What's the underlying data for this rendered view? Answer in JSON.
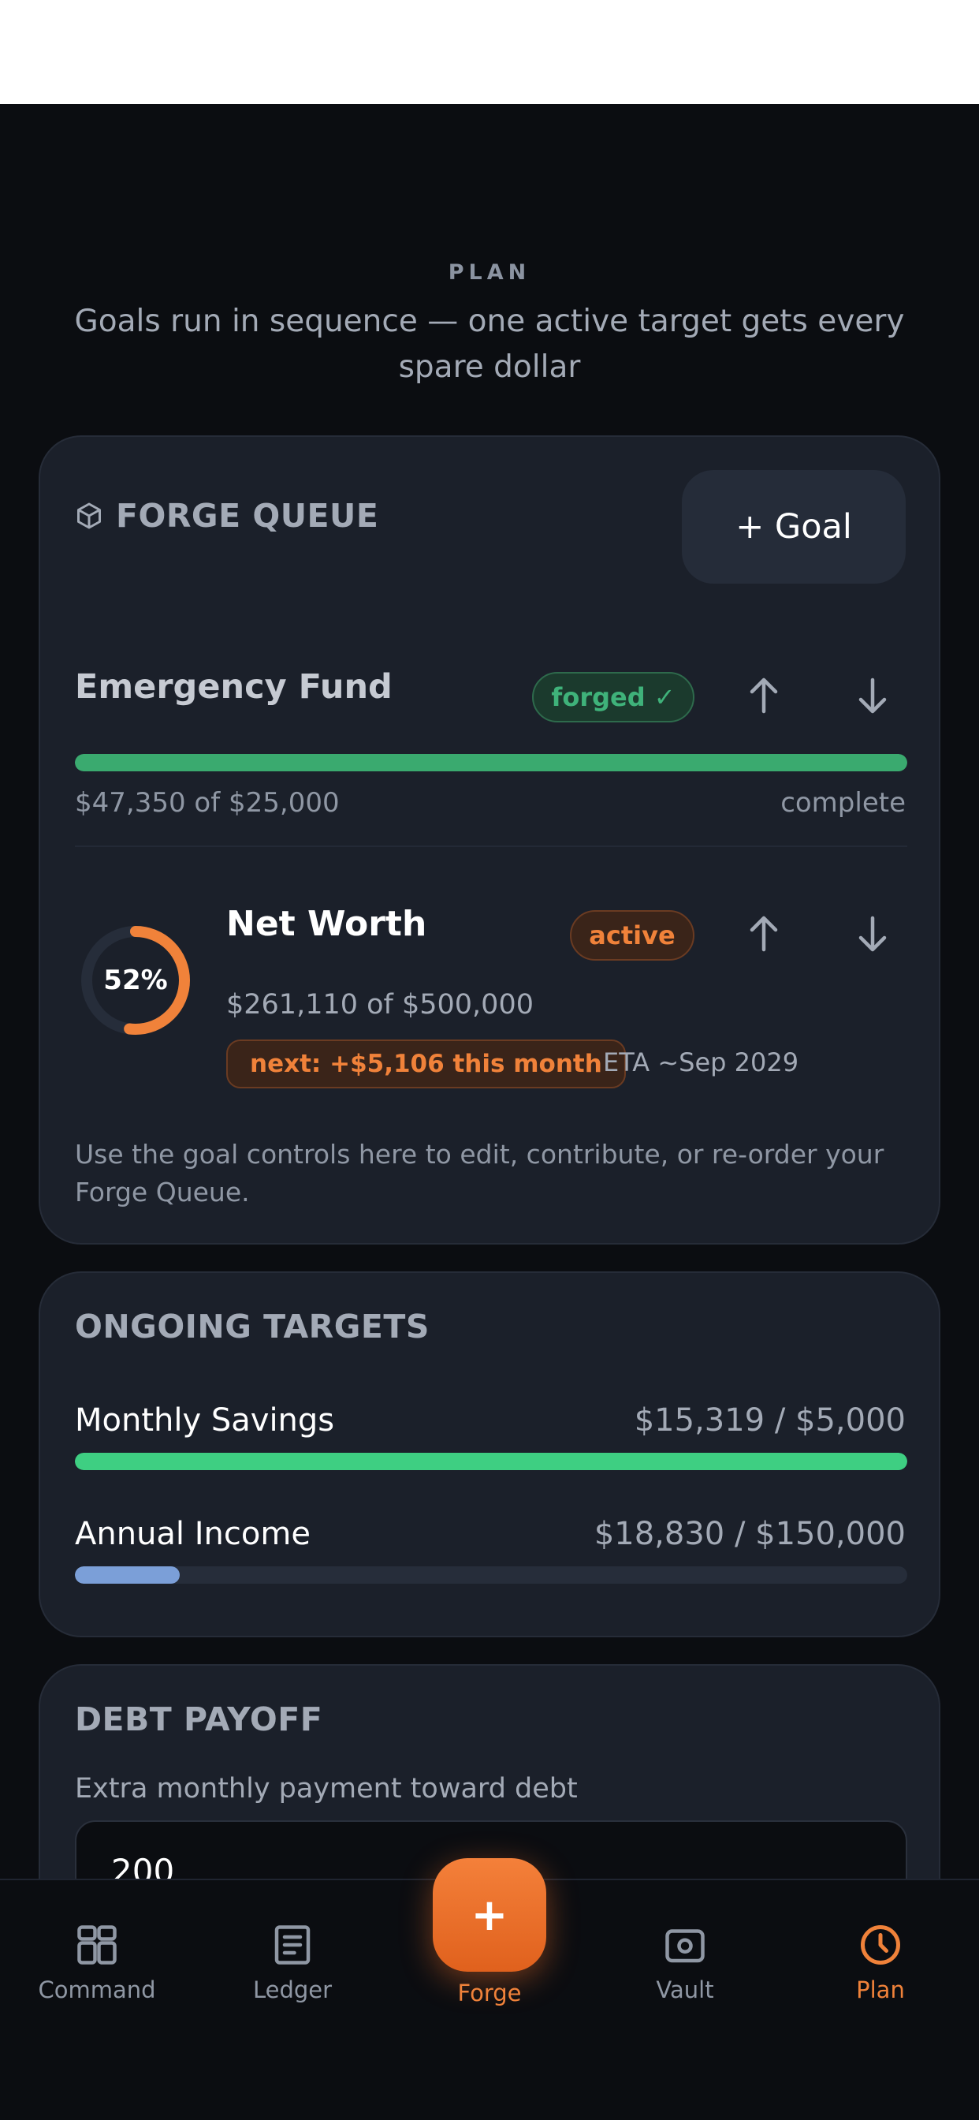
{
  "header": {
    "eyebrow": "PLAN",
    "subtitle": "Goals run in sequence — one active target gets every spare dollar"
  },
  "forge_queue": {
    "title": "FORGE QUEUE",
    "add_goal_label": "+ Goal",
    "goals": [
      {
        "name": "Emergency Fund",
        "badge": "forged ✓",
        "amount_text": "$47,350 of $25,000",
        "status_text": "complete",
        "progress": 1.0
      },
      {
        "name": "Net Worth",
        "badge": "active",
        "percent_label": "52%",
        "progress": 0.52,
        "amount_text": "$261,110 of $500,000",
        "next_text": "next: +$5,106 this month",
        "eta_text": "ETA ~Sep 2029"
      }
    ],
    "hint": "Use the goal controls here to edit, contribute, or re-order your Forge Queue."
  },
  "ongoing_targets": {
    "title": "ONGOING TARGETS",
    "rows": [
      {
        "label": "Monthly Savings",
        "value": "$15,319 / $5,000",
        "progress": 1.0,
        "color": "#3ecf82"
      },
      {
        "label": "Annual Income",
        "value": "$18,830 / $150,000",
        "progress": 0.1255,
        "color": "#7b9fd8"
      }
    ]
  },
  "debt_payoff": {
    "title": "DEBT PAYOFF",
    "label": "Extra monthly payment toward debt",
    "value": "200"
  },
  "nav": {
    "items": [
      {
        "label": "Command",
        "icon": "grid-icon"
      },
      {
        "label": "Ledger",
        "icon": "document-icon"
      },
      {
        "label": "Forge",
        "icon": "plus-icon"
      },
      {
        "label": "Vault",
        "icon": "vault-icon"
      },
      {
        "label": "Plan",
        "icon": "clock-icon"
      }
    ],
    "active": "Plan",
    "accent": "#f0823a"
  },
  "colors": {
    "background": "#0b0d11",
    "card": "#1b202a",
    "accent": "#f0823a",
    "success": "#3aaa6f"
  }
}
